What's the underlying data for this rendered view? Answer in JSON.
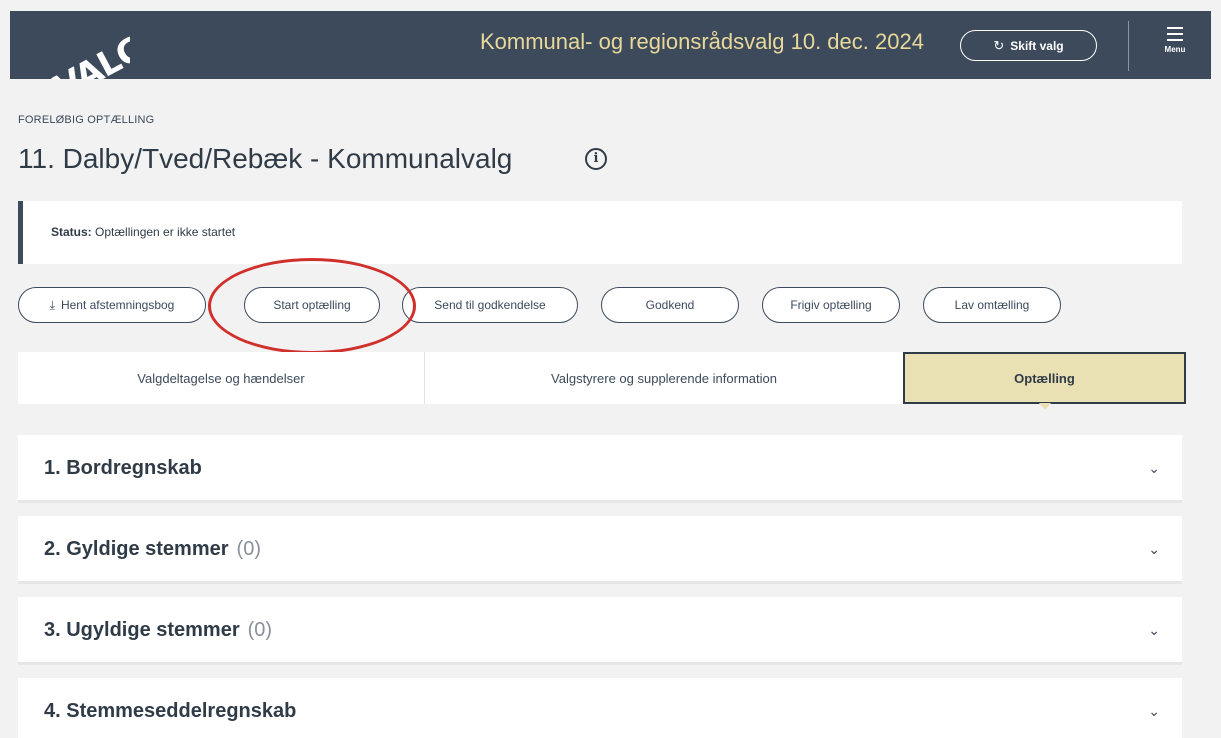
{
  "header": {
    "logo_text": "VALG",
    "election_title": "Kommunal- og regionsrådsvalg 10. dec. 2024",
    "switch_button": {
      "icon": "refresh-icon",
      "label": "Skift valg"
    },
    "menu_button": {
      "icon": "hamburger-icon",
      "label": "Menu"
    },
    "background_color": "#3c4a5b",
    "accent_color": "#e8d89a"
  },
  "page": {
    "eyebrow": "FORELØBIG OPTÆLLING",
    "title": "11. Dalby/Tved/Rebæk - Kommunalvalg",
    "info_icon": "info-icon"
  },
  "status": {
    "label": "Status:",
    "value": "Optællingen er ikke startet"
  },
  "actions": [
    {
      "label": "Hent afstemningsbog",
      "icon": "download-icon"
    },
    {
      "label": "Start optælling"
    },
    {
      "label": "Send til godkendelse"
    },
    {
      "label": "Godkend"
    },
    {
      "label": "Frigiv optælling"
    },
    {
      "label": "Lav omtælling"
    }
  ],
  "annotation": {
    "highlighted_action": "Start optælling",
    "color": "#d0302c"
  },
  "tabs": [
    {
      "label": "Valgdeltagelse og hændelser",
      "active": false
    },
    {
      "label": "Valgstyrere og supplerende information",
      "active": false
    },
    {
      "label": "Optælling",
      "active": true
    }
  ],
  "sections": [
    {
      "title": "1. Bordregnskab",
      "count": ""
    },
    {
      "title": "2. Gyldige stemmer",
      "count": "(0)"
    },
    {
      "title": "3. Ugyldige stemmer",
      "count": "(0)"
    },
    {
      "title": "4. Stemmeseddelregnskab",
      "count": ""
    }
  ]
}
